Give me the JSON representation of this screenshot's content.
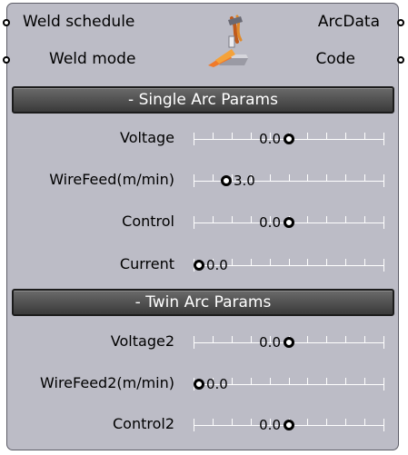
{
  "component": {
    "inputs": [
      {
        "label": "Weld schedule"
      },
      {
        "label": "Weld mode"
      }
    ],
    "outputs": [
      {
        "label": "ArcData"
      },
      {
        "label": "Code"
      }
    ],
    "icon": "welding-torch-icon"
  },
  "sections": {
    "single": {
      "title": "- Single Arc Params"
    },
    "twin": {
      "title": "- Twin Arc Params"
    }
  },
  "sliders": [
    {
      "label": "Voltage",
      "value": "0.0",
      "position": 0.5
    },
    {
      "label": "WireFeed(m/min)",
      "value": "3.0",
      "position": 0.15
    },
    {
      "label": "Control",
      "value": "0.0",
      "position": 0.5
    },
    {
      "label": "Current",
      "value": "0.0",
      "position": 0.0
    },
    {
      "label": "Voltage2",
      "value": "0.0",
      "position": 0.5
    },
    {
      "label": "WireFeed2(m/min)",
      "value": "0.0",
      "position": 0.0
    },
    {
      "label": "Control2",
      "value": "0.0",
      "position": 0.5
    }
  ],
  "colors": {
    "node_body": "#bcbcc6",
    "section_header": "#4a4a4a",
    "track": "#ffffff",
    "knob_border": "#000000"
  }
}
